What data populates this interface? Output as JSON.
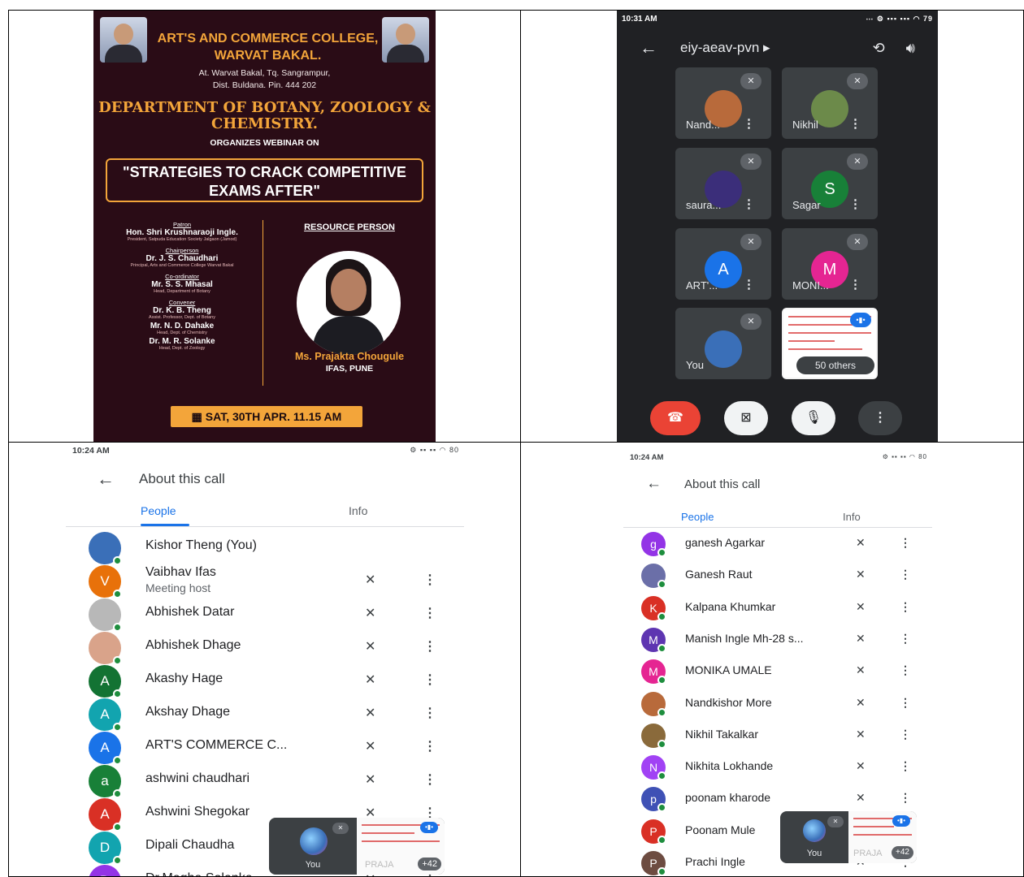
{
  "poster": {
    "college": "ART'S AND COMMERCE COLLEGE, WARVAT BAKAL.",
    "address_line1": "At. Warvat Bakal, Tq. Sangrampur,",
    "address_line2": "Dist. Buldana. Pin. 444 202",
    "department": "DEPARTMENT OF BOTANY, ZOOLOGY & CHEMISTRY.",
    "organizes": "ORGANIZES WEBINAR ON",
    "webinar_title": "\"STRATEGIES TO CRACK COMPETITIVE EXAMS AFTER\"",
    "committee": [
      {
        "role": "Patron",
        "name": "Hon. Shri Krushnaraoji Ingle.",
        "sub": "President, Satpuda Education Society Jalgaon (Jamod)"
      },
      {
        "role": "Chairperson",
        "name": "Dr. J. S. Chaudhari",
        "sub": "Principal, Arts and Commerce College Warvat Bakal"
      },
      {
        "role": "Co-ordinator",
        "name": "Mr. S. S. Mhasal",
        "sub": "Head, Department of Botany"
      },
      {
        "role": "Convener",
        "name": "Dr. K. B. Theng",
        "sub": "Assist. Professor, Dept. of Botany"
      },
      {
        "role": "",
        "name": "Mr. N. D. Dahake",
        "sub": "Head, Dept. of Chemistry"
      },
      {
        "role": "",
        "name": "Dr. M. R. Solanke",
        "sub": "Head, Dept. of Zoology"
      }
    ],
    "resource_label": "RESOURCE PERSON",
    "resource_name": "Ms. Prajakta Chougule",
    "resource_org": "IFAS, PUNE",
    "date": "SAT, 30TH APR. 11.15 AM"
  },
  "meet": {
    "time": "10:31 AM",
    "battery": "79",
    "meeting_code": "eiy-aeav-pvn",
    "tiles": [
      {
        "label": "Nand...",
        "initial": "",
        "color": "#b86a3b"
      },
      {
        "label": "Nikhil",
        "initial": "",
        "color": "#6c8a4a"
      },
      {
        "label": "saura...",
        "initial": "",
        "color": "#3b2e7a"
      },
      {
        "label": "Sagar",
        "initial": "S",
        "color": "#188038"
      },
      {
        "label": "ART'...",
        "initial": "A",
        "color": "#1a73e8"
      },
      {
        "label": "MONI...",
        "initial": "M",
        "color": "#e52592"
      },
      {
        "label": "You",
        "initial": "",
        "color": "#3a6fb8"
      }
    ],
    "others_label": "50 others"
  },
  "people_left": {
    "time": "10:24 AM",
    "battery": "80",
    "title": "About this call",
    "tab_people": "People",
    "tab_info": "Info",
    "host_label": "Meeting host",
    "rows": [
      {
        "name": "Kishor Theng (You)",
        "initial": "",
        "color": "#3a6fb8",
        "host": false
      },
      {
        "name": "Vaibhav Ifas",
        "initial": "V",
        "color": "#e8710a",
        "host": true
      },
      {
        "name": "Abhishek Datar",
        "initial": "",
        "color": "#b8b8b8",
        "host": false
      },
      {
        "name": "Abhishek Dhage",
        "initial": "",
        "color": "#d9a38a",
        "host": false
      },
      {
        "name": "Akashy Hage",
        "initial": "A",
        "color": "#137333",
        "host": false
      },
      {
        "name": "Akshay Dhage",
        "initial": "A",
        "color": "#12a4af",
        "host": false
      },
      {
        "name": "ART'S COMMERCE C...",
        "initial": "A",
        "color": "#1a73e8",
        "host": false
      },
      {
        "name": "ashwini chaudhari",
        "initial": "a",
        "color": "#188038",
        "host": false
      },
      {
        "name": "Ashwini Shegokar",
        "initial": "A",
        "color": "#d93025",
        "host": false
      },
      {
        "name": "Dipali Chaudha",
        "initial": "D",
        "color": "#12a4af",
        "host": false
      },
      {
        "name": "Dr.Megha Solanke",
        "initial": "D",
        "color": "#9334e6",
        "host": false
      }
    ],
    "pip_you": "You",
    "pip_name": "PRAJA",
    "pip_count": "+42"
  },
  "people_right": {
    "time": "10:24 AM",
    "battery": "80",
    "title": "About this call",
    "tab_people": "People",
    "tab_info": "Info",
    "rows": [
      {
        "name": "ganesh Agarkar",
        "initial": "g",
        "color": "#9334e6"
      },
      {
        "name": "Ganesh Raut",
        "initial": "",
        "color": "#6b6fa8"
      },
      {
        "name": "Kalpana Khumkar",
        "initial": "K",
        "color": "#d93025"
      },
      {
        "name": "Manish Ingle Mh-28 s...",
        "initial": "M",
        "color": "#5e35b1"
      },
      {
        "name": "MONIKA UMALE",
        "initial": "M",
        "color": "#e52592"
      },
      {
        "name": "Nandkishor More",
        "initial": "",
        "color": "#b86a3b"
      },
      {
        "name": "Nikhil Takalkar",
        "initial": "",
        "color": "#8a6a3b"
      },
      {
        "name": "Nikhita Lokhande",
        "initial": "N",
        "color": "#a142f4"
      },
      {
        "name": "poonam kharode",
        "initial": "p",
        "color": "#3f51b5"
      },
      {
        "name": "Poonam Mule",
        "initial": "P",
        "color": "#d93025"
      },
      {
        "name": "Prachi Ingle",
        "initial": "P",
        "color": "#6d4c41"
      }
    ],
    "pip_you": "You",
    "pip_name": "PRAJA",
    "pip_count": "+42"
  }
}
